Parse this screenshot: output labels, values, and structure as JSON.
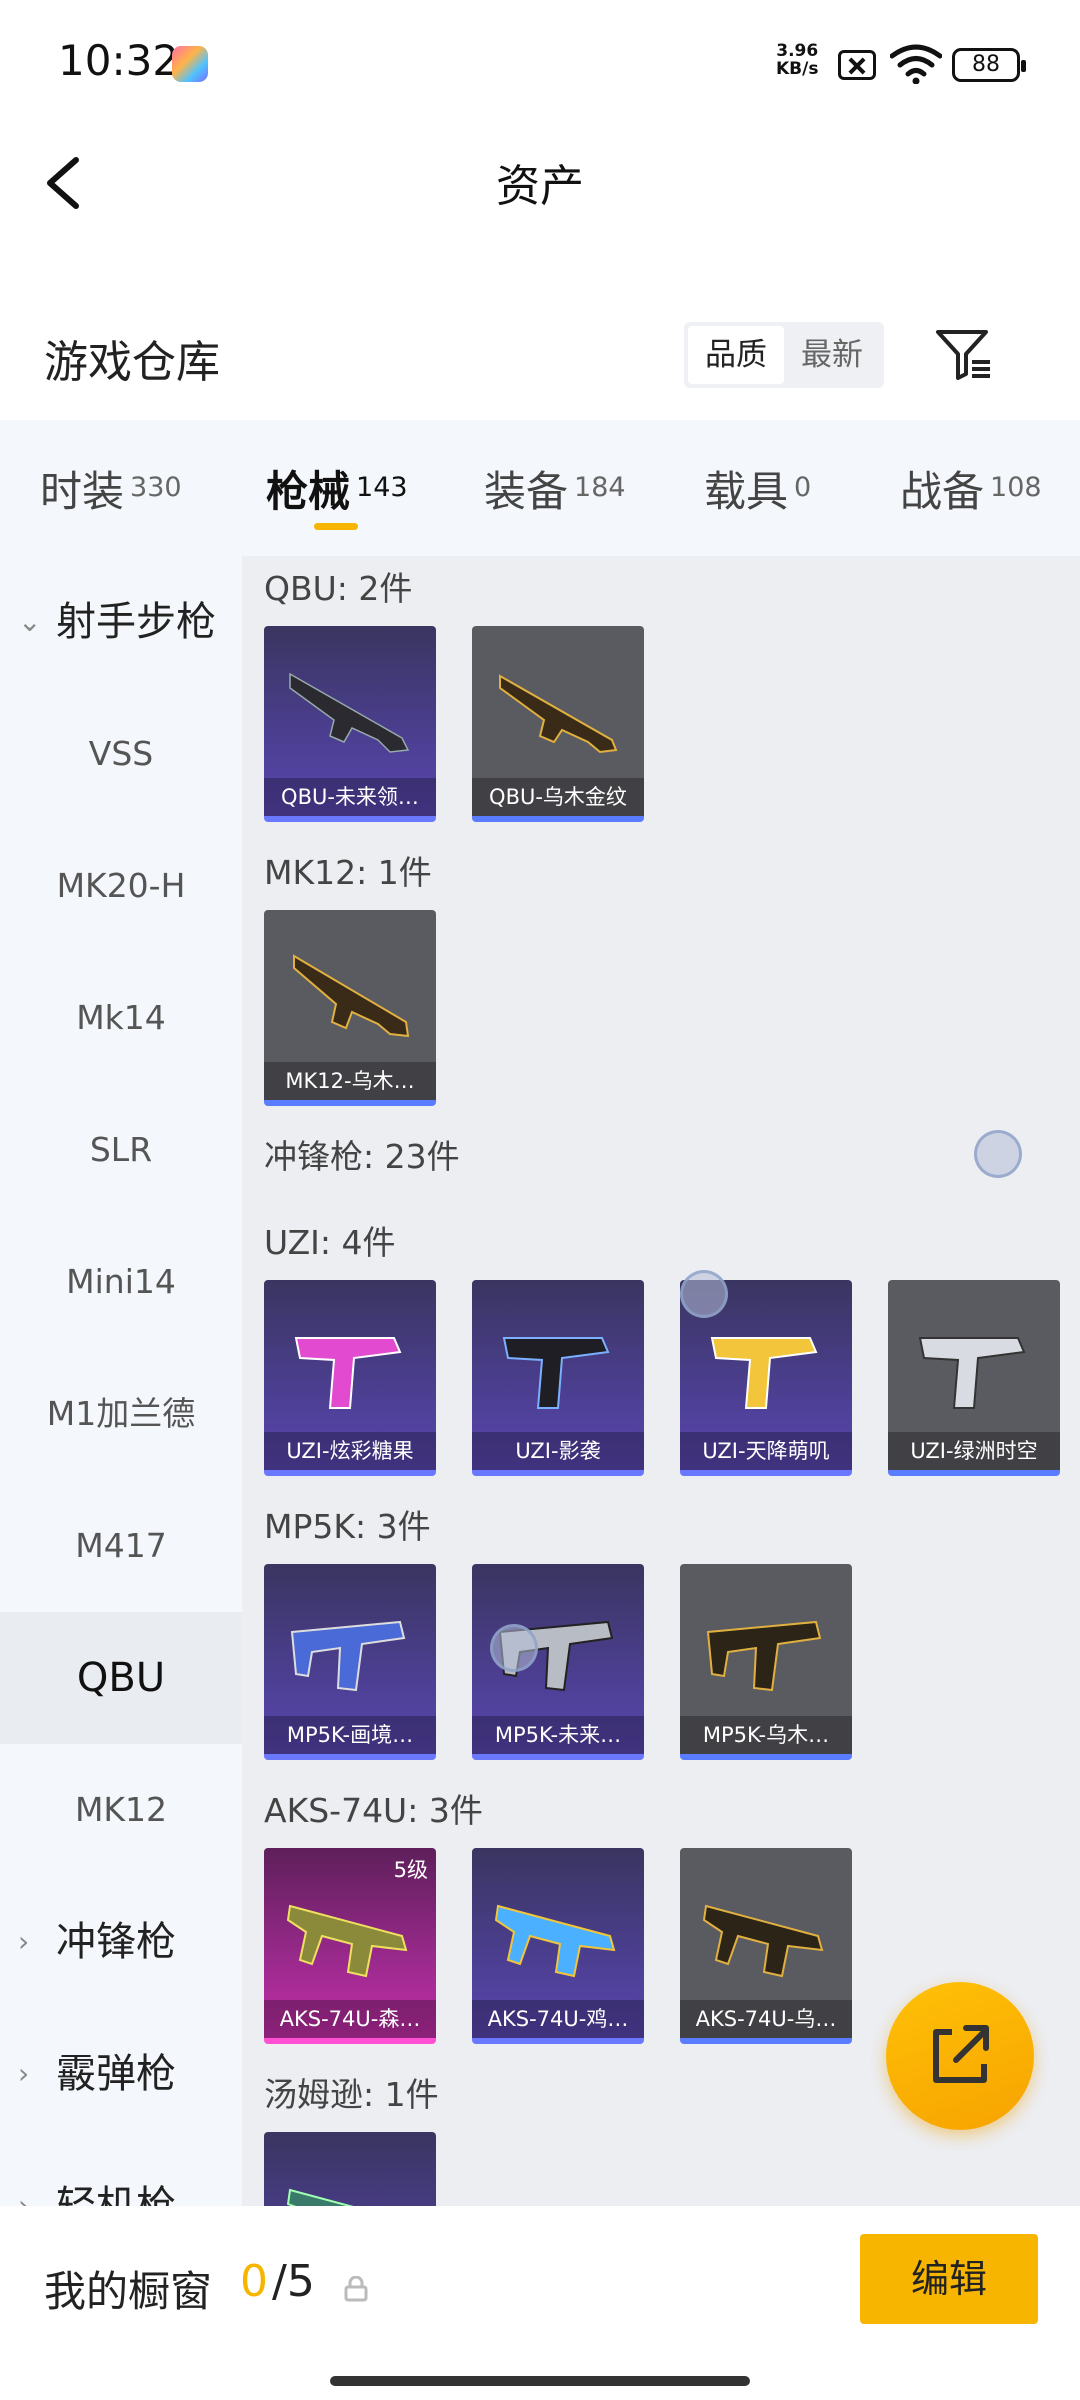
{
  "status_bar": {
    "time": "10:32",
    "net_speed_value": "3.96",
    "net_speed_unit": "KB/s",
    "battery": "88"
  },
  "header": {
    "title": "资产"
  },
  "warehouse": {
    "title": "游戏仓库",
    "sort_options": [
      "品质",
      "最新"
    ],
    "sort_selected": "品质"
  },
  "tabs": [
    {
      "label": "时装",
      "count": "330"
    },
    {
      "label": "枪械",
      "count": "143",
      "active": true
    },
    {
      "label": "装备",
      "count": "184"
    },
    {
      "label": "载具",
      "count": "0"
    },
    {
      "label": "战备",
      "count": "108"
    }
  ],
  "sidebar": {
    "group_open": "射手步枪",
    "items": [
      "VSS",
      "MK20-H",
      "Mk14",
      "SLR",
      "Mini14",
      "M1加兰德",
      "M417",
      "QBU",
      "MK12"
    ],
    "selected": "QBU",
    "groups_closed": [
      "冲锋枪",
      "霰弹枪",
      "轻机枪"
    ]
  },
  "content": {
    "sections": [
      {
        "title": "QBU: 2件",
        "cards": [
          {
            "name": "QBU-未来领…",
            "style": "purple",
            "icon": "rifle-dark-icon"
          },
          {
            "name": "QBU-乌木金纹",
            "style": "gray",
            "icon": "rifle-gold-icon"
          }
        ]
      },
      {
        "title": "MK12: 1件",
        "cards": [
          {
            "name": "MK12-乌木…",
            "style": "gray",
            "icon": "rifle-gold-icon"
          }
        ]
      },
      {
        "title": "冲锋枪: 23件",
        "cards": []
      },
      {
        "title": "UZI: 4件",
        "cards": [
          {
            "name": "UZI-炫彩糖果",
            "style": "purple",
            "icon": "uzi-pink-icon"
          },
          {
            "name": "UZI-影袭",
            "style": "purple",
            "icon": "uzi-dark-icon"
          },
          {
            "name": "UZI-天降萌叽",
            "style": "purple",
            "icon": "uzi-yellow-icon"
          },
          {
            "name": "UZI-绿洲时空",
            "style": "gray",
            "icon": "uzi-silver-icon"
          }
        ]
      },
      {
        "title": "MP5K: 3件",
        "cards": [
          {
            "name": "MP5K-画境…",
            "style": "purple",
            "icon": "mp5k-blue-icon"
          },
          {
            "name": "MP5K-未来…",
            "style": "purple",
            "icon": "mp5k-silver-icon"
          },
          {
            "name": "MP5K-乌木…",
            "style": "gray",
            "icon": "mp5k-gold-icon"
          }
        ]
      },
      {
        "title": "AKS-74U: 3件",
        "cards": [
          {
            "name": "AKS-74U-森…",
            "style": "pink",
            "icon": "aks-camo-icon",
            "level": "5级"
          },
          {
            "name": "AKS-74U-鸡…",
            "style": "purple",
            "icon": "aks-blue-icon"
          },
          {
            "name": "AKS-74U-乌…",
            "style": "gray",
            "icon": "aks-gold-icon"
          }
        ]
      },
      {
        "title": "汤姆逊: 1件",
        "cards": [
          {
            "name": "",
            "style": "purple",
            "icon": "tommy-icon"
          }
        ]
      }
    ]
  },
  "bottom_bar": {
    "title": "我的橱窗",
    "current": "0",
    "max": "/5",
    "edit_label": "编辑"
  },
  "colors": {
    "accent": "#f7b500",
    "purple_card": "#4c3f92",
    "gray_card": "#5a5b60",
    "pink_card": "#9b2a8d"
  }
}
